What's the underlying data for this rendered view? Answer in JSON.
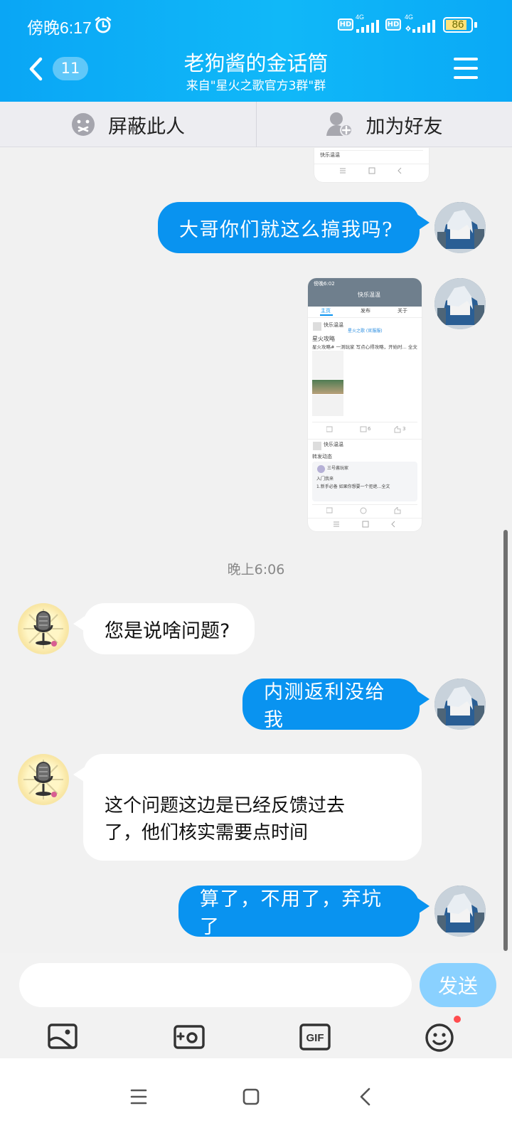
{
  "status_bar": {
    "time": "傍晚6:17",
    "network_1": "4G",
    "network_2": "4G",
    "hd_badge": "HD",
    "battery": "86"
  },
  "header": {
    "back_count": "11",
    "title": "老狗酱的金话筒",
    "subtitle": "来自\"星火之歌官方3群\"群"
  },
  "actions": {
    "block_label": "屏蔽此人",
    "add_friend_label": "加为好友"
  },
  "messages": {
    "m1": "大哥你们就这么搞我吗?",
    "time_separator": "晚上6:06",
    "m2": "您是说啥问题?",
    "m3": "内测返利没给我",
    "m4_line1": "这个问题这边是已经反馈过去",
    "m4_line2": "了，他们核实需要点时间",
    "m5": "算了，不用了，弃坑了"
  },
  "screenshot_preview": {
    "status_time": "傍晚6:02",
    "header_name": "快乐温温",
    "tab_home": "主页",
    "tab_posts": "发布",
    "tab_follow": "关于",
    "post1_author": "快乐温温",
    "post1_tag": "星火之歌 (官服服)",
    "post1_title": "星火攻略",
    "post1_body": "星火攻略# 一测玩家 写点心得攻略，开始时... 全文",
    "post1_comments": "6",
    "post1_likes": "3",
    "post2_author": "快乐温温",
    "post2_type": "转发动态",
    "post2_quote_author": "三号酱玩家",
    "post2_quote_title": "入门我来",
    "post2_quote_body": "1.新手必备 如果你想要一个拒绝...全文"
  },
  "input": {
    "placeholder": "",
    "send_label": "发送"
  },
  "toolbar": {
    "icons": [
      "image-icon",
      "camera-icon",
      "gif-icon",
      "emoji-icon"
    ],
    "gif_label": "GIF"
  },
  "colors": {
    "header_blue": "#0aa6f5",
    "bubble_blue": "#0993f0",
    "send_disabled": "#8ad1ff",
    "badge_red": "#ff4d4f"
  }
}
